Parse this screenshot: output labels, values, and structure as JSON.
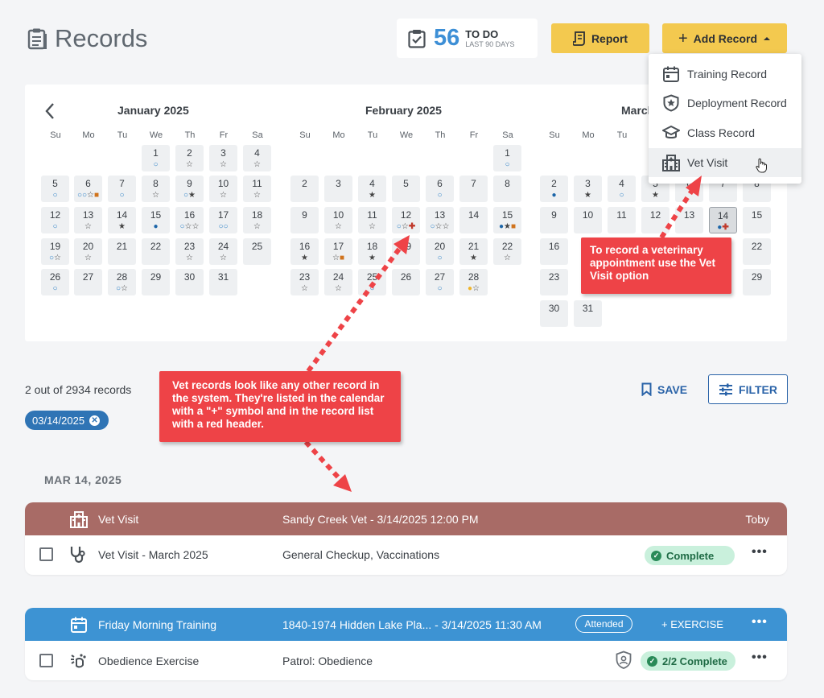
{
  "page": {
    "title": "Records"
  },
  "todo": {
    "count": "56",
    "label": "TO DO",
    "sub": "LAST 90 DAYS"
  },
  "buttons": {
    "report": "Report",
    "add_record": "Add Record",
    "save": "SAVE",
    "filter": "FILTER"
  },
  "add_menu": [
    {
      "label": "Training Record",
      "icon": "calendar-icon"
    },
    {
      "label": "Deployment Record",
      "icon": "shield-star-icon"
    },
    {
      "label": "Class Record",
      "icon": "mortarboard-icon"
    },
    {
      "label": "Vet Visit",
      "icon": "hospital-icon"
    }
  ],
  "calendar": {
    "weekdays": [
      "Su",
      "Mo",
      "Tu",
      "We",
      "Th",
      "Fr",
      "Sa"
    ],
    "months": [
      {
        "title": "January 2025",
        "days": [
          {
            "d": "1",
            "marks": [
              "circle"
            ]
          },
          {
            "d": "2",
            "marks": [
              "star"
            ]
          },
          {
            "d": "3",
            "marks": [
              "star"
            ]
          },
          {
            "d": "4",
            "marks": [
              "star"
            ]
          },
          {
            "d": "5",
            "marks": [
              "circle"
            ]
          },
          {
            "d": "6",
            "marks": [
              "circle",
              "circle",
              "star",
              "square"
            ]
          },
          {
            "d": "7",
            "marks": [
              "circle"
            ]
          },
          {
            "d": "8",
            "marks": [
              "star"
            ]
          },
          {
            "d": "9",
            "marks": [
              "circle",
              "star-filled"
            ]
          },
          {
            "d": "10",
            "marks": [
              "star"
            ]
          },
          {
            "d": "11",
            "marks": [
              "star"
            ]
          },
          {
            "d": "12",
            "marks": [
              "circle"
            ]
          },
          {
            "d": "13",
            "marks": [
              "star"
            ]
          },
          {
            "d": "14",
            "marks": [
              "star-filled"
            ]
          },
          {
            "d": "15",
            "marks": [
              "dot"
            ]
          },
          {
            "d": "16",
            "marks": [
              "circle",
              "star",
              "star"
            ]
          },
          {
            "d": "17",
            "marks": [
              "circle",
              "circle"
            ]
          },
          {
            "d": "18",
            "marks": [
              "star"
            ]
          },
          {
            "d": "19",
            "marks": [
              "circle",
              "star"
            ]
          },
          {
            "d": "20",
            "marks": [
              "star"
            ]
          },
          {
            "d": "21",
            "marks": []
          },
          {
            "d": "22",
            "marks": []
          },
          {
            "d": "23",
            "marks": [
              "star"
            ]
          },
          {
            "d": "24",
            "marks": [
              "star"
            ]
          },
          {
            "d": "25",
            "marks": []
          },
          {
            "d": "26",
            "marks": [
              "circle"
            ]
          },
          {
            "d": "27",
            "marks": []
          },
          {
            "d": "28",
            "marks": [
              "circle",
              "star"
            ]
          },
          {
            "d": "29",
            "marks": []
          },
          {
            "d": "30",
            "marks": []
          },
          {
            "d": "31",
            "marks": []
          }
        ]
      },
      {
        "title": "February 2025",
        "days": [
          {
            "d": "1",
            "marks": [
              "circle"
            ]
          },
          {
            "d": "2",
            "marks": []
          },
          {
            "d": "3",
            "marks": []
          },
          {
            "d": "4",
            "marks": [
              "star-filled"
            ]
          },
          {
            "d": "5",
            "marks": []
          },
          {
            "d": "6",
            "marks": [
              "circle"
            ]
          },
          {
            "d": "7",
            "marks": []
          },
          {
            "d": "8",
            "marks": []
          },
          {
            "d": "9",
            "marks": []
          },
          {
            "d": "10",
            "marks": [
              "star"
            ]
          },
          {
            "d": "11",
            "marks": [
              "star"
            ]
          },
          {
            "d": "12",
            "marks": [
              "circle",
              "star",
              "plus"
            ]
          },
          {
            "d": "13",
            "marks": [
              "circle",
              "star",
              "star"
            ]
          },
          {
            "d": "14",
            "marks": []
          },
          {
            "d": "15",
            "marks": [
              "dot",
              "star-filled",
              "square"
            ]
          },
          {
            "d": "16",
            "marks": [
              "star-filled"
            ]
          },
          {
            "d": "17",
            "marks": [
              "star",
              "square"
            ]
          },
          {
            "d": "18",
            "marks": [
              "star-filled"
            ]
          },
          {
            "d": "19",
            "marks": []
          },
          {
            "d": "20",
            "marks": [
              "circle"
            ]
          },
          {
            "d": "21",
            "marks": [
              "star-filled"
            ]
          },
          {
            "d": "22",
            "marks": [
              "star"
            ]
          },
          {
            "d": "23",
            "marks": [
              "star"
            ]
          },
          {
            "d": "24",
            "marks": [
              "star"
            ]
          },
          {
            "d": "25",
            "marks": [
              "circle"
            ]
          },
          {
            "d": "26",
            "marks": []
          },
          {
            "d": "27",
            "marks": [
              "circle"
            ]
          },
          {
            "d": "28",
            "marks": [
              "yellow-dot",
              "star"
            ]
          }
        ]
      },
      {
        "title": "March 2025",
        "days": [
          {
            "d": "2",
            "marks": [
              "dot"
            ]
          },
          {
            "d": "3",
            "marks": [
              "star-filled"
            ]
          },
          {
            "d": "4",
            "marks": [
              "circle"
            ]
          },
          {
            "d": "5",
            "marks": [
              "star-filled"
            ]
          },
          {
            "d": "6",
            "marks": []
          },
          {
            "d": "7",
            "marks": []
          },
          {
            "d": "8",
            "marks": []
          },
          {
            "d": "9",
            "marks": []
          },
          {
            "d": "10",
            "marks": []
          },
          {
            "d": "11",
            "marks": []
          },
          {
            "d": "12",
            "marks": []
          },
          {
            "d": "13",
            "marks": []
          },
          {
            "d": "14",
            "marks": [
              "dot",
              "plus"
            ],
            "selected": true
          },
          {
            "d": "15",
            "marks": []
          },
          {
            "d": "16",
            "marks": []
          },
          {
            "d": "22",
            "marks": []
          },
          {
            "d": "23",
            "marks": []
          },
          {
            "d": "29",
            "marks": []
          },
          {
            "d": "30",
            "marks": []
          },
          {
            "d": "31",
            "marks": []
          }
        ]
      }
    ]
  },
  "annotations": {
    "vet_visit_tip": "To record a veterinary appointment use the Vet Visit option",
    "records_tip": "Vet records look like any other record in the system. They're listed in the calendar with a \"+\" symbol and in the record list with a red header."
  },
  "results": {
    "count_text": "2 out of 2934 records",
    "filter_chip": "03/14/2025"
  },
  "list": {
    "date_header": "MAR 14, 2025",
    "cards": [
      {
        "header": {
          "type": "Vet Visit",
          "detail": "Sandy Creek Vet - 3/14/2025 12:00 PM",
          "dog": "Toby",
          "color": "#a86b66",
          "icon": "hospital-icon"
        },
        "rows": [
          {
            "name": "Vet Visit - March 2025",
            "detail": "General Checkup, Vaccinations",
            "status": "Complete",
            "icon": "stethoscope-icon"
          }
        ]
      },
      {
        "header": {
          "type": "Friday Morning Training",
          "detail": "1840-1974 Hidden Lake Pla... - 3/14/2025 11:30 AM",
          "badge": "Attended",
          "action": "+ EXERCISE",
          "color": "#3d93d3",
          "icon": "calendar-icon"
        },
        "rows": [
          {
            "name": "Obedience Exercise",
            "detail": "Patrol: Obedience",
            "status": "2/2 Complete",
            "icon": "dog-training-icon"
          }
        ]
      }
    ]
  }
}
